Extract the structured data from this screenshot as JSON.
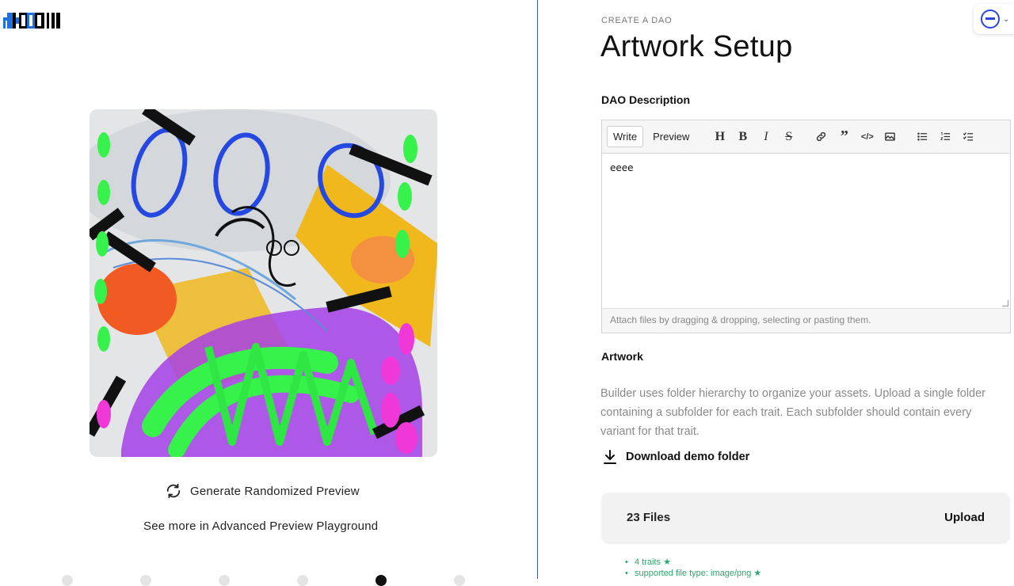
{
  "left": {
    "generate_label": "Generate Randomized Preview",
    "advanced_link": "See more in Advanced Preview Playground",
    "progress": {
      "total_steps": 6,
      "current_step": 5
    }
  },
  "header": {
    "eyebrow": "CREATE A DAO",
    "title": "Artwork Setup"
  },
  "description_section": {
    "label": "DAO Description",
    "tabs": [
      "Write",
      "Preview"
    ],
    "active_tab": "Write",
    "toolbar_icons": [
      "heading-icon",
      "bold-icon",
      "italic-icon",
      "strikethrough-icon",
      "link-icon",
      "quote-icon",
      "code-icon",
      "image-icon",
      "bullet-list-icon",
      "numbered-list-icon",
      "task-list-icon"
    ],
    "value": "eeee",
    "attach_hint": "Attach files by dragging & dropping, selecting or pasting them."
  },
  "artwork_section": {
    "label": "Artwork",
    "description": "Builder uses folder hierarchy to organize your assets. Upload a single folder containing a subfolder for each trait. Each subfolder should contain every variant for that trait.",
    "download_label": "Download demo folder",
    "files_label": "23 Files",
    "upload_label": "Upload",
    "checks": [
      "4 traits ★",
      "supported file type: image/png ★"
    ]
  },
  "colors": {
    "accent": "#2a46d6",
    "success": "#2aa86a",
    "divider": "#3a55c8"
  }
}
